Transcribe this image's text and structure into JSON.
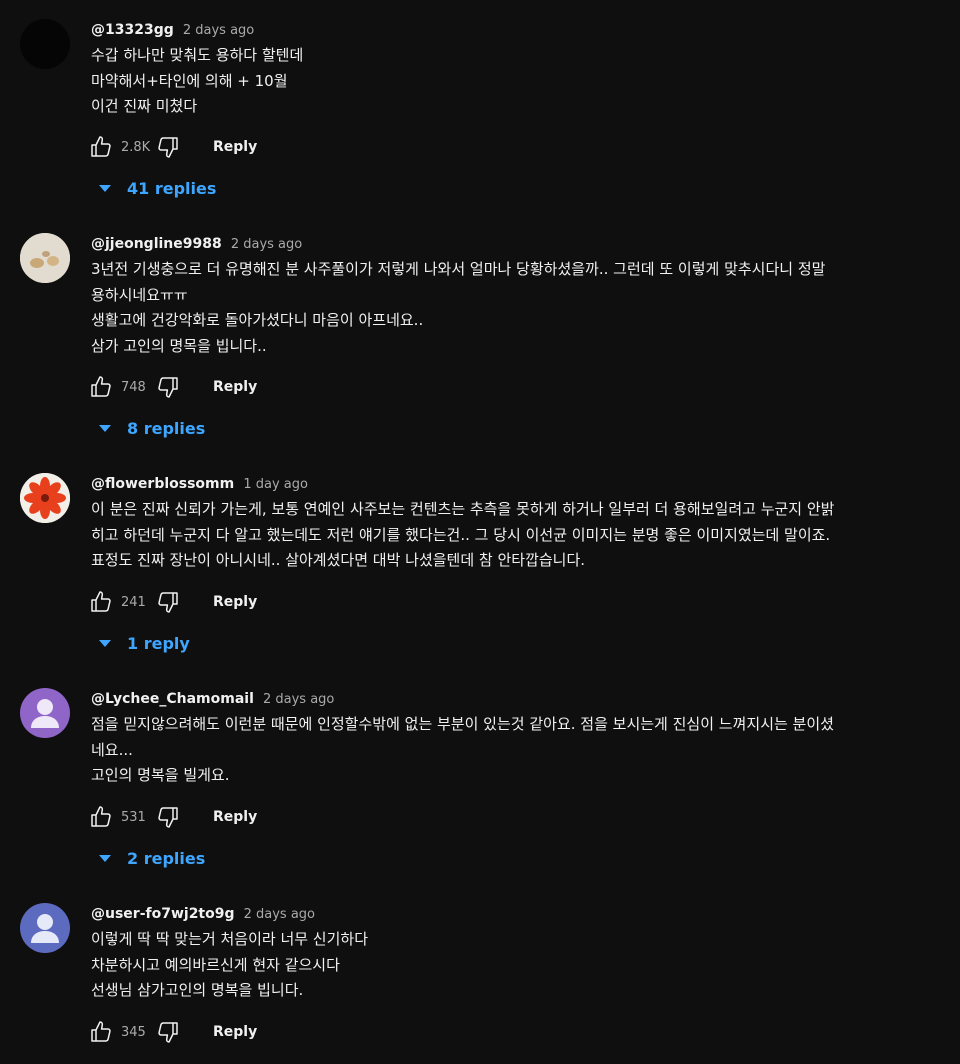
{
  "comments": [
    {
      "author": "@13323gg",
      "time": "2 days ago",
      "lines": [
        "수갑 하나만 맞춰도 용하다 할텐데",
        "마약해서+타인에 의해 + 10월",
        "이건 진짜 미쳤다"
      ],
      "likes": "2.8K",
      "reply_label": "Reply",
      "replies_label": "41 replies",
      "avatar": "dark-avatar"
    },
    {
      "author": "@jjeongline9988",
      "time": "2 days ago",
      "lines": [
        "3년전 기생충으로 더 유명해진 분 사주풀이가 저렇게 나와서 얼마나 당황하셨을까.. 그런데 또 이렇게 맞추시다니 정말",
        "용하시네요ㅠㅠ",
        "생활고에 건강악화로 돌아가셨다니 마음이 아프네요..",
        "삼가 고인의 명목을 빕니다.."
      ],
      "likes": "748",
      "reply_label": "Reply",
      "replies_label": "8 replies",
      "avatar": "photo-avatar"
    },
    {
      "author": "@flowerblossomm",
      "time": "1 day ago",
      "lines": [
        "이 분은 진짜 신뢰가 가는게, 보통 연예인 사주보는 컨텐츠는 추측을 못하게 하거나 일부러 더 용해보일려고 누군지 안밝",
        "히고 하던데 누군지 다 알고 했는데도 저런 얘기를 했다는건.. 그 당시 이선균 이미지는 분명 좋은 이미지였는데 말이죠.",
        "표정도 진짜 장난이 아니시네.. 살아계셨다면 대박 나셨을텐데 참 안타깝습니다."
      ],
      "likes": "241",
      "reply_label": "Reply",
      "replies_label": "1 reply",
      "avatar": "flower-avatar"
    },
    {
      "author": "@Lychee_Chamomail",
      "time": "2 days ago",
      "lines": [
        "점을 믿지않으려해도 이런분 때문에 인정할수밖에 없는 부분이 있는것 같아요. 점을 보시는게 진심이 느껴지시는 분이셨",
        "네요...",
        "고인의 명복을 빌게요."
      ],
      "likes": "531",
      "reply_label": "Reply",
      "replies_label": "2 replies",
      "avatar": "default-avatar-purple"
    },
    {
      "author": "@user-fo7wj2to9g",
      "time": "2 days ago",
      "lines": [
        "이렇게 딱 딱 맞는거 처음이라 너무 신기하다",
        "차분하시고 예의바르신게 현자 같으시다",
        "선생님 삼가고인의 명복을 빕니다."
      ],
      "likes": "345",
      "reply_label": "Reply",
      "replies_label": "",
      "avatar": "default-avatar-blue"
    }
  ],
  "colors": {
    "background": "#0f0f0f",
    "text": "#f1f1f1",
    "secondary_text": "#aaaaaa",
    "link_blue": "#3ea6ff"
  },
  "icons": {
    "like": "thumb-up-icon",
    "dislike": "thumb-down-icon",
    "expand": "triangle-down-icon"
  }
}
